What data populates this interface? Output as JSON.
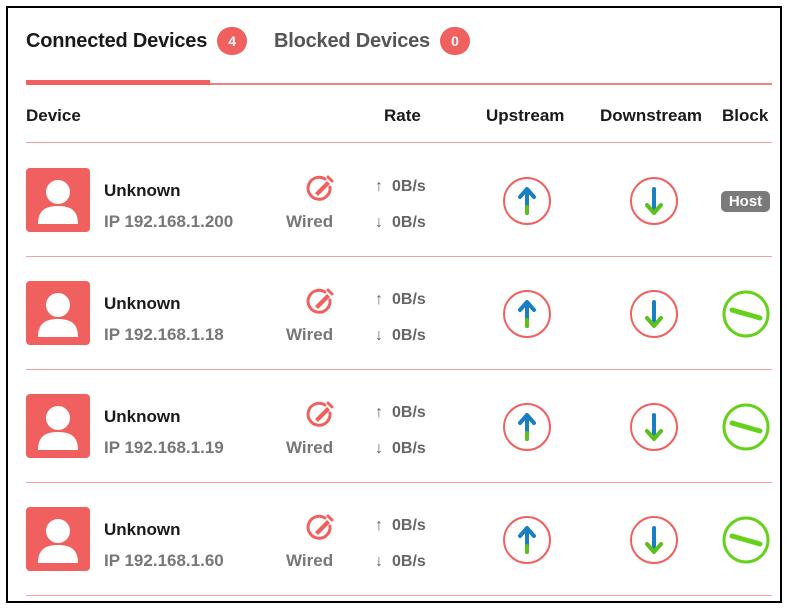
{
  "tabs": [
    {
      "label": "Connected Devices",
      "count": "4",
      "active": true
    },
    {
      "label": "Blocked Devices",
      "count": "0",
      "active": false
    }
  ],
  "columns": {
    "device": "Device",
    "rate": "Rate",
    "upstream": "Upstream",
    "downstream": "Downstream",
    "block": "Block"
  },
  "devices": [
    {
      "name": "Unknown",
      "ip": "IP 192.168.1.200",
      "connection": "Wired",
      "up_rate": "0B/s",
      "down_rate": "0B/s",
      "block": "Host"
    },
    {
      "name": "Unknown",
      "ip": "IP 192.168.1.18",
      "connection": "Wired",
      "up_rate": "0B/s",
      "down_rate": "0B/s",
      "block": ""
    },
    {
      "name": "Unknown",
      "ip": "IP 192.168.1.19",
      "connection": "Wired",
      "up_rate": "0B/s",
      "down_rate": "0B/s",
      "block": ""
    },
    {
      "name": "Unknown",
      "ip": "IP 192.168.1.60",
      "connection": "Wired",
      "up_rate": "0B/s",
      "down_rate": "0B/s",
      "block": ""
    }
  ],
  "icons": {
    "avatar": "user-avatar-icon",
    "edit": "edit-pencil-icon",
    "upstream": "arrow-up-circle-icon",
    "downstream": "arrow-down-circle-icon",
    "block": "block-toggle-icon",
    "rate_up": "↑",
    "rate_down": "↓"
  },
  "colors": {
    "accent": "#f0605e",
    "arrow_blue": "#1a7fc0",
    "arrow_green": "#5cc01a",
    "block_green": "#66d11a",
    "host_badge": "#7a7a7a"
  }
}
